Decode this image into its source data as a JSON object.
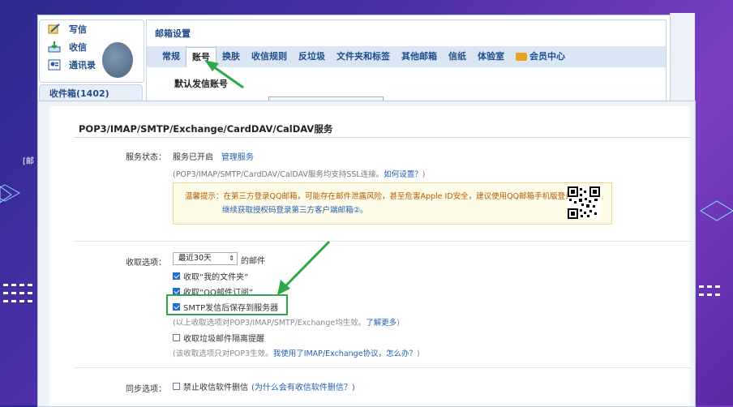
{
  "nav": {
    "items": [
      {
        "label": "写信",
        "icon": "pencil-icon"
      },
      {
        "label": "收信",
        "icon": "inbox-download-icon"
      },
      {
        "label": "通讯录",
        "icon": "contacts-icon"
      }
    ],
    "inbox_label": "收件箱(1402)"
  },
  "settings": {
    "title": "邮箱设置",
    "tabs": [
      "常规",
      "账号",
      "换肤",
      "收信规则",
      "反垃圾",
      "文件夹和标签",
      "其他邮箱",
      "信纸",
      "体验室",
      "会员中心"
    ],
    "active_tab": "账号",
    "default_account_label": "默认发信账号"
  },
  "left_peek": "[邮",
  "service": {
    "section_title": "POP3/IMAP/SMTP/Exchange/CardDAV/CalDAV服务",
    "status_label": "服务状态：",
    "status_value": "服务已开启",
    "manage_link": "管理服务",
    "ssl_note": "(POP3/IMAP/SMTP/CardDAV/CalDAV服务均支持SSL连接。",
    "ssl_link": "如何设置？",
    "ssl_close": ")",
    "warning_line1": "温馨提示：在第三方登录QQ邮箱，可能存在邮件泄露风险，甚至危害Apple ID安全，建议使用QQ邮箱手机版登录。",
    "warning_line2": "继续获取授权码登录第三方客户端邮箱②。"
  },
  "receive": {
    "label": "收取选项：",
    "range_value": "最近30天",
    "range_suffix": "的邮件",
    "options": [
      {
        "label": "收取“我的文件夹”",
        "checked": true
      },
      {
        "label": "收取“QQ邮件订阅”",
        "checked": true
      },
      {
        "label": "SMTP发信后保存到服务器",
        "checked": true
      }
    ],
    "hint1": "(以上收取选项对POP3/IMAP/SMTP/Exchange均生效。",
    "hint1_link": "了解更多",
    "hint1_close": ")",
    "junk_label": "收取垃圾邮件隔离提醒",
    "junk_checked": false,
    "hint2": "(该收取选项只对POP3生效。",
    "hint2_link": "我使用了IMAP/Exchange协议，怎么办？",
    "hint2_close": ")"
  },
  "sync": {
    "label": "同步选项：",
    "option_label": "禁止收信软件删信",
    "option_link": "(为什么会有收信软件删信？)",
    "checked": false
  },
  "colors": {
    "accent_green": "#2ea84a",
    "link_blue": "#1f5fb6",
    "checkbox_blue": "#1f6fd0"
  }
}
